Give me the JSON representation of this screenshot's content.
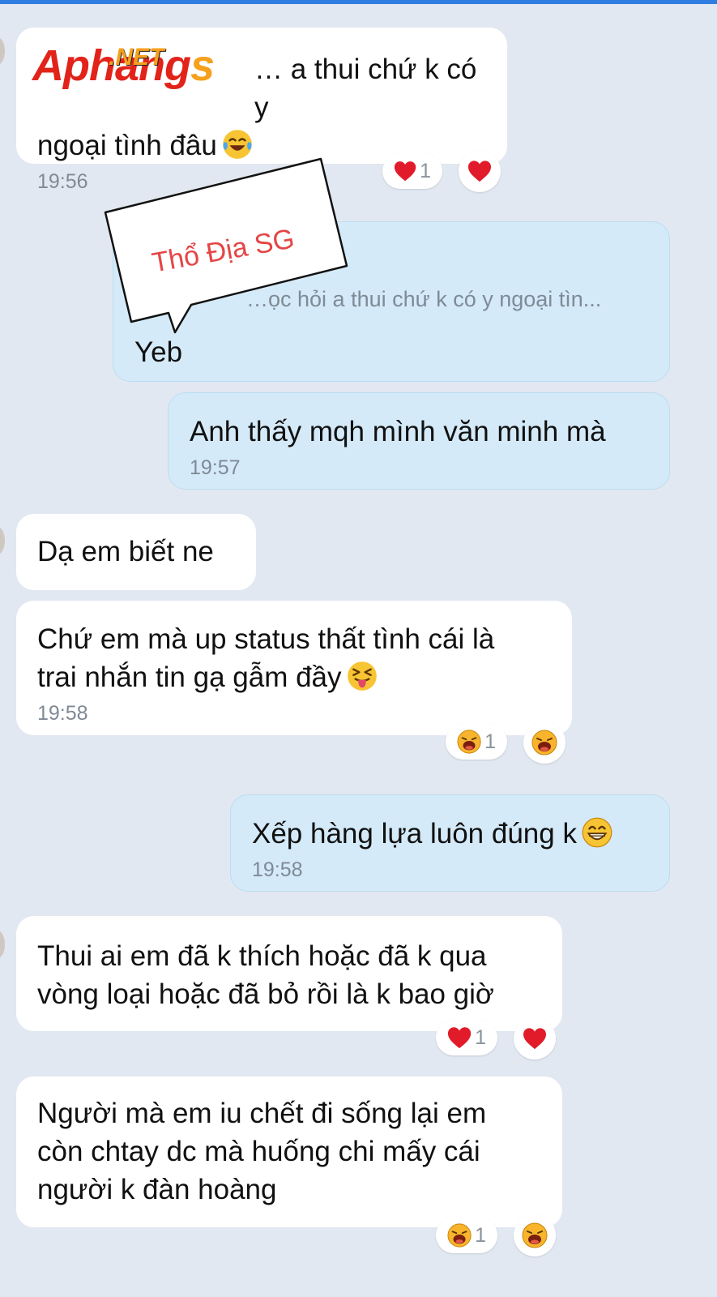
{
  "watermark": {
    "brand": "Aphang",
    "brand_tail": "s",
    "suffix": ".NET"
  },
  "callout": {
    "label": "Thổ Địa SG"
  },
  "colors": {
    "heart": "#e11b2a",
    "laugh_face": "#f7b42c",
    "out_bubble": "#d4eaf8",
    "background": "#e2e8f1"
  },
  "messages": [
    {
      "line1": "… a thui chứ k có y",
      "line2": "ngoại tình đâu",
      "emoji": "joy-emoji",
      "time": "19:56",
      "reaction": {
        "icon": "heart-icon",
        "count": "1"
      }
    },
    {
      "quote": "…ọc hỏi a thui chứ k có y ngoại tìn...",
      "text": "Yeb"
    },
    {
      "text": "Anh thấy mqh mình văn minh mà",
      "time": "19:57"
    },
    {
      "text": "Dạ em biết ne"
    },
    {
      "line1": "Chứ em mà up status thất tình cái là",
      "line2": "trai nhắn tin gạ gẫm đầy",
      "emoji": "squint-tongue-emoji",
      "time": "19:58",
      "reaction": {
        "icon": "laughing-face-icon",
        "count": "1"
      }
    },
    {
      "text": "Xếp hàng lựa luôn đúng k",
      "emoji": "grin-emoji",
      "time": "19:58"
    },
    {
      "line1": "Thui ai em đã k thích hoặc đã k qua",
      "line2": "vòng loại hoặc đã bỏ rồi là k bao giờ",
      "reaction": {
        "icon": "heart-icon",
        "count": "1"
      }
    },
    {
      "line1": "Người mà em iu chết đi sống lại em",
      "line2": "còn chtay dc mà huống chi mấy cái",
      "line3": "người k đàn hoàng",
      "reaction": {
        "icon": "laughing-face-icon",
        "count": "1"
      }
    }
  ]
}
